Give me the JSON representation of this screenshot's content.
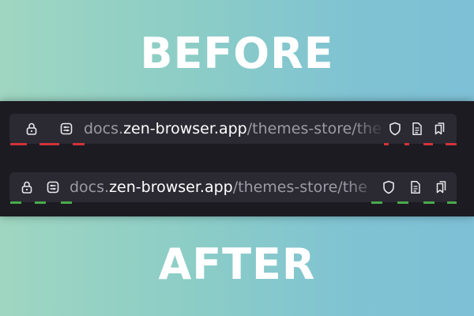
{
  "before_label": "BEFORE",
  "after_label": "AFTER",
  "before_bar": {
    "url_prefix": "docs.",
    "url_host": "zen-browser.app",
    "url_path": "/themes-store/the"
  },
  "after_bar": {
    "url_prefix": "docs.",
    "url_host": "zen-browser.app",
    "url_path": "/themes-store/the"
  },
  "icons": [
    "lock-icon",
    "site-controls-icon",
    "tracking-shield-icon",
    "reader-mode-icon",
    "bookmark-icon"
  ],
  "colors": {
    "before_marker": "#d1323a",
    "after_marker": "#4aaa4c",
    "toolbar_bg": "#1c1b22",
    "urlbar_bg": "#2b2a33"
  }
}
